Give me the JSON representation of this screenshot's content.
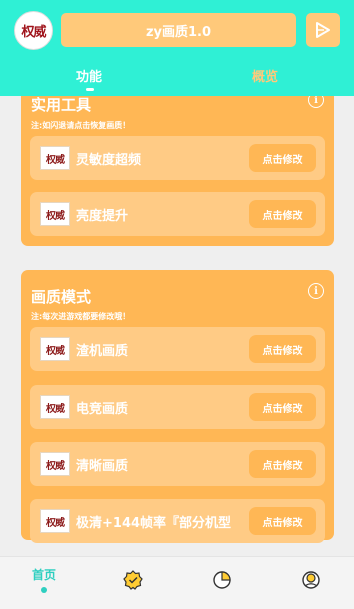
{
  "header": {
    "logo_text": "权威",
    "title": "zy画质1.0",
    "tabs": [
      {
        "label": "功能"
      },
      {
        "label": "概览"
      }
    ]
  },
  "cards": [
    {
      "title": "实用工具",
      "note": "注:如闪退请点击恢复画质！",
      "rows": [
        {
          "logo": "权威",
          "label": "灵敏度超频",
          "button": "点击修改"
        },
        {
          "logo": "权威",
          "label": "亮度提升",
          "button": "点击修改"
        }
      ]
    },
    {
      "title": "画质模式",
      "note": "注:每次进游戏都要修改哦！",
      "rows": [
        {
          "logo": "权威",
          "label": "渣机画质",
          "button": "点击修改"
        },
        {
          "logo": "权威",
          "label": "电竞画质",
          "button": "点击修改"
        },
        {
          "logo": "权威",
          "label": "清晰画质",
          "button": "点击修改"
        },
        {
          "logo": "权威",
          "label": "极清+144帧率『部分机型",
          "button": "点击修改"
        }
      ]
    }
  ],
  "bottom_nav": {
    "home_label": "首页",
    "icons": [
      "badge-check-icon",
      "pie-chart-icon",
      "user-profile-icon"
    ]
  },
  "colors": {
    "header": "#2ff0d5",
    "card": "#ffb755",
    "row": "#ffcb85",
    "accent_nav": "#2ecfc0"
  }
}
